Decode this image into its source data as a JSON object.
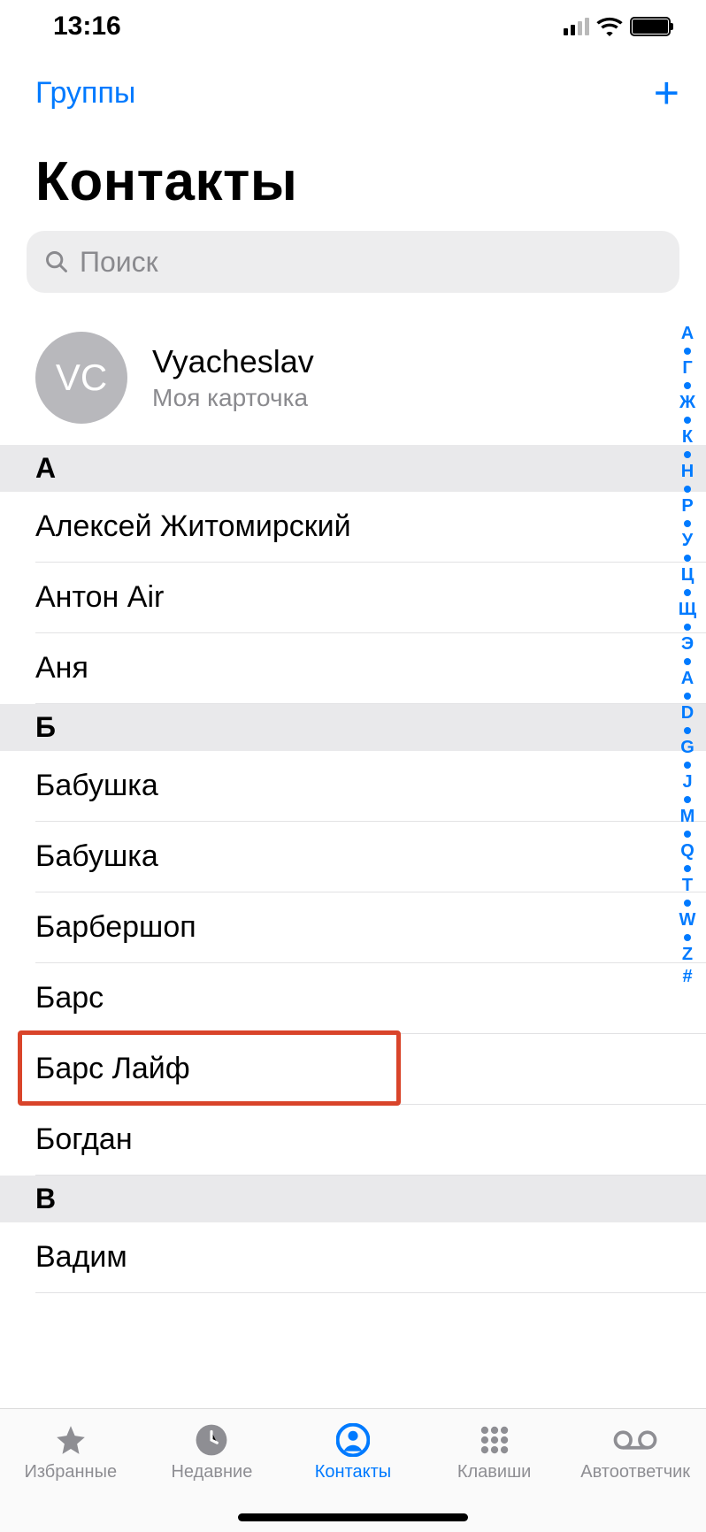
{
  "status": {
    "time": "13:16"
  },
  "nav": {
    "groups": "Группы"
  },
  "title": "Контакты",
  "search": {
    "placeholder": "Поиск"
  },
  "myCard": {
    "initials": "VC",
    "name": "Vyacheslav",
    "sub": "Моя карточка"
  },
  "sections": [
    {
      "letter": "А",
      "rows": [
        "Алексей Житомирский",
        "Антон Air",
        "Аня"
      ]
    },
    {
      "letter": "Б",
      "rows": [
        "Бабушка",
        "Бабушка",
        "Барбершоп",
        "Барс",
        "Барс Лайф",
        "Богдан"
      ],
      "highlightIndex": 4
    },
    {
      "letter": "В",
      "rows": [
        "Вадим"
      ]
    }
  ],
  "indexStrip": [
    "А",
    "●",
    "Г",
    "●",
    "Ж",
    "●",
    "К",
    "●",
    "Н",
    "●",
    "Р",
    "●",
    "У",
    "●",
    "Ц",
    "●",
    "Щ",
    "●",
    "Э",
    "●",
    "A",
    "●",
    "D",
    "●",
    "G",
    "●",
    "J",
    "●",
    "M",
    "●",
    "Q",
    "●",
    "T",
    "●",
    "W",
    "●",
    "Z",
    "#"
  ],
  "tabs": {
    "favorites": "Избранные",
    "recents": "Недавние",
    "contacts": "Контакты",
    "keypad": "Клавиши",
    "voicemail": "Автоответчик"
  }
}
